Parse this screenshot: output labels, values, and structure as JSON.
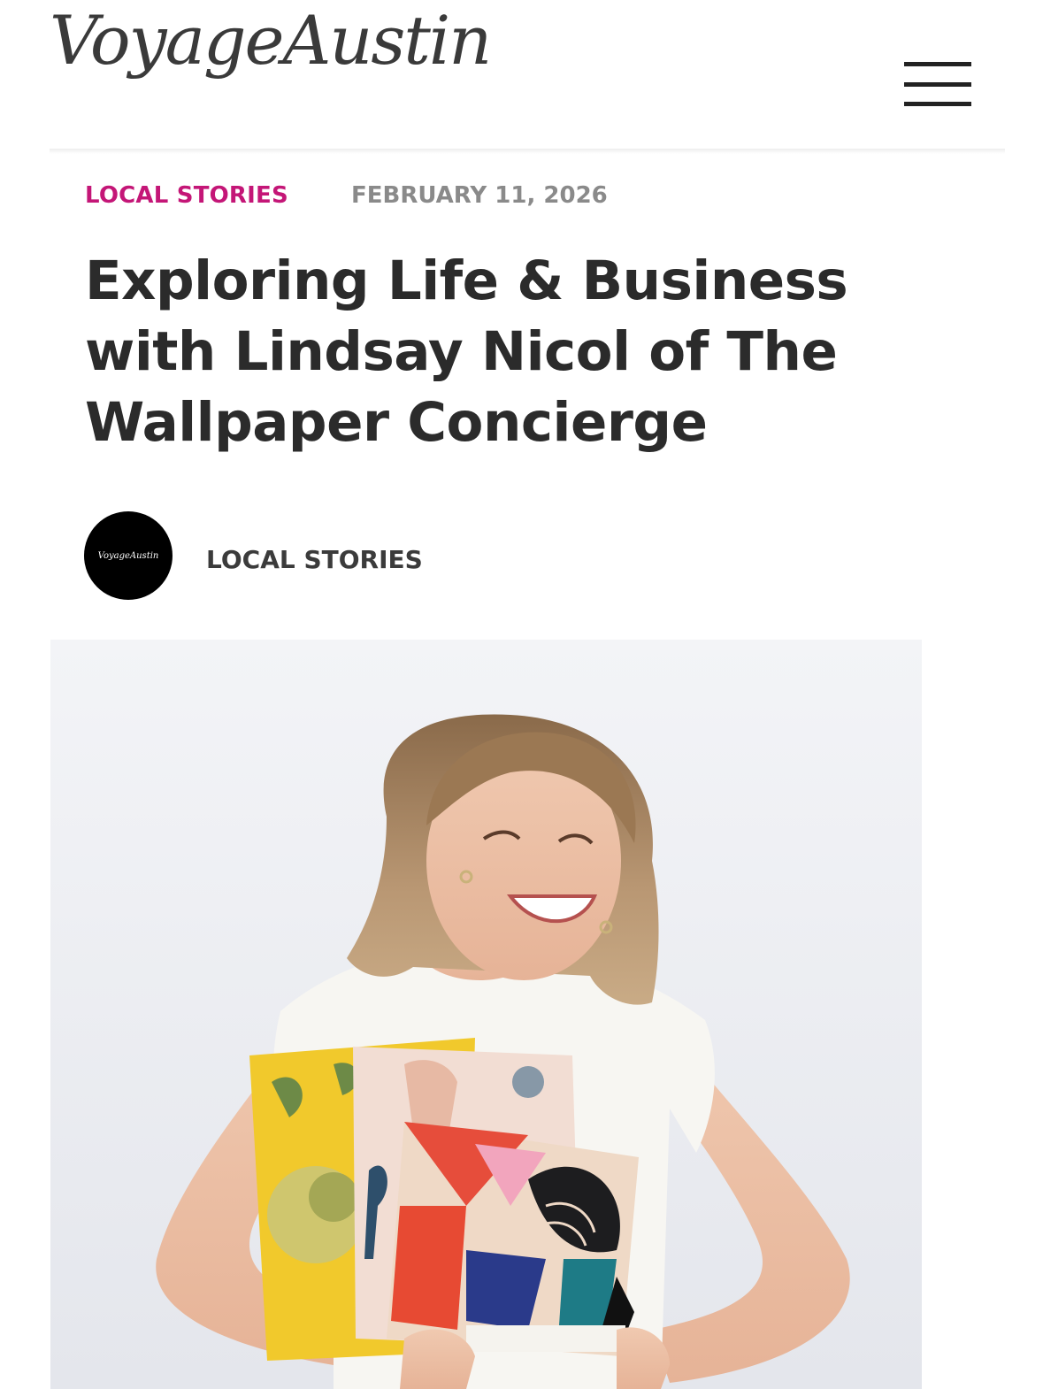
{
  "header": {
    "logo_text": "VoyageAustin",
    "menu_icon": "hamburger-menu-icon"
  },
  "article": {
    "category": "LOCAL STORIES",
    "date": "FEBRUARY 11, 2026",
    "title": "Exploring Life & Business with Lindsay Nicol of The Wallpaper Concierge",
    "author": {
      "avatar_text": "VoyageAustin",
      "name": "LOCAL STORIES"
    }
  },
  "colors": {
    "category_accent": "#c41677",
    "date_gray": "#8a8a8a",
    "title_text": "#2b2b2b",
    "avatar_bg": "#000000"
  }
}
